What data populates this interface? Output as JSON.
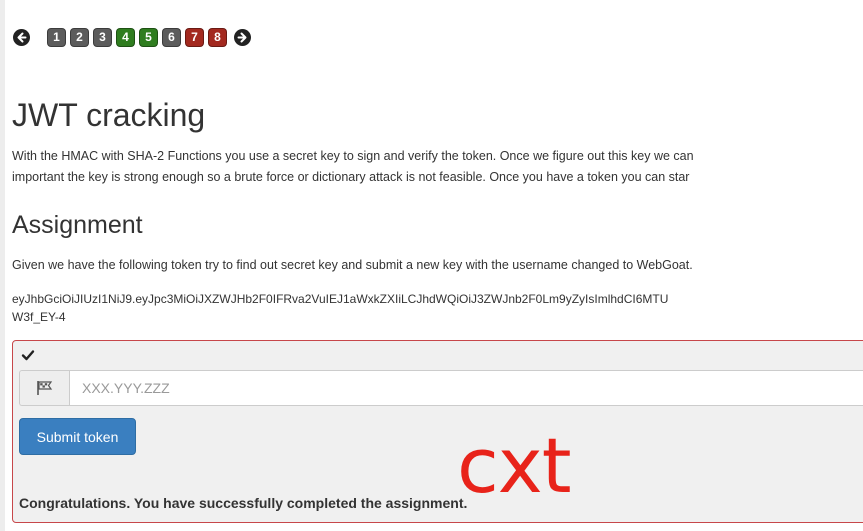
{
  "pagination": {
    "prev_icon": "arrow-left-icon",
    "next_icon": "arrow-right-icon",
    "pages": [
      {
        "label": "1",
        "status": "gray"
      },
      {
        "label": "2",
        "status": "gray"
      },
      {
        "label": "3",
        "status": "gray"
      },
      {
        "label": "4",
        "status": "green"
      },
      {
        "label": "5",
        "status": "green"
      },
      {
        "label": "6",
        "status": "gray"
      },
      {
        "label": "7",
        "status": "red"
      },
      {
        "label": "8",
        "status": "red"
      }
    ]
  },
  "lesson": {
    "title": "JWT cracking",
    "intro_line1": "With the HMAC with SHA-2 Functions you use a secret key to sign and verify the token. Once we figure out this key we can",
    "intro_line2": "important the key is strong enough so a brute force or dictionary attack is not feasible. Once you have a token you can star"
  },
  "assignment": {
    "title": "Assignment",
    "description": "Given we have the following token try to find out secret key and submit a new key with the username changed to WebGoat.",
    "token_line1": "eyJhbGciOiJIUzI1NiJ9.eyJpc3MiOiJXZWJHb2F0IFRva2VuIEJ1aWxkZXIiLCJhdWQiOiJ3ZWJnb2F0Lm9yZyIsImlhdCI6MTU",
    "token_line2": "W3f_EY-4"
  },
  "form": {
    "status_icon": "checkmark-icon",
    "input_icon": "flag-icon",
    "input_placeholder": "XXX.YYY.ZZZ",
    "input_value": "",
    "submit_label": "Submit token",
    "feedback": "Congratulations. You have successfully completed the assignment."
  },
  "overlay": {
    "text": "cxt"
  },
  "colors": {
    "page_gray": "#5c5c5c",
    "page_green": "#2f7d1f",
    "page_red": "#a3291f",
    "submit_blue": "#3a7fc0",
    "attack_border": "#c7474a",
    "overlay_red": "#e8231a"
  }
}
